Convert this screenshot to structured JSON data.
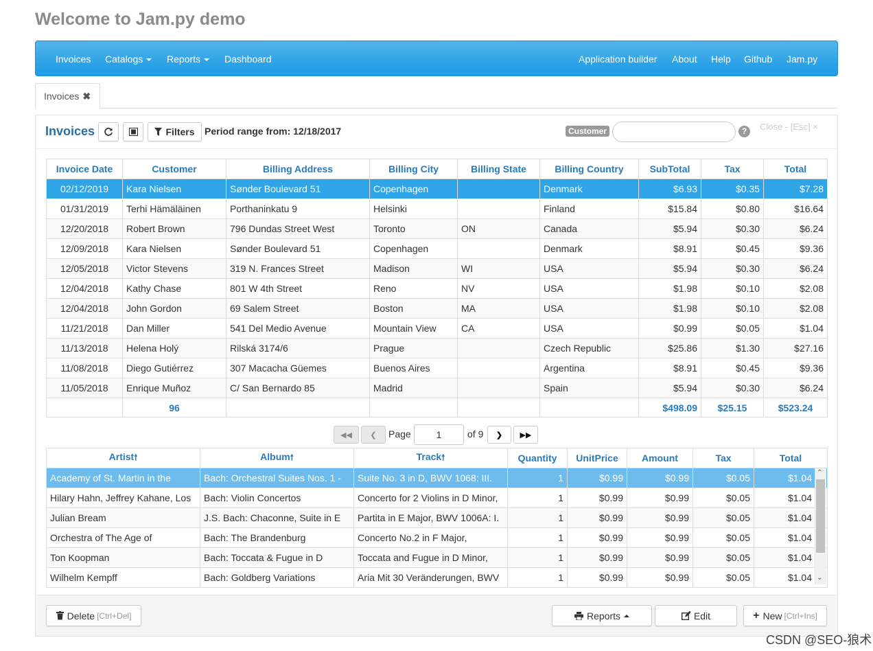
{
  "page": {
    "title": "Welcome to Jam.py demo"
  },
  "nav": {
    "left": [
      "Invoices",
      "Catalogs",
      "Reports",
      "Dashboard"
    ],
    "right": [
      "Application builder",
      "About",
      "Help",
      "Github",
      "Jam.py"
    ]
  },
  "tab": {
    "label": "Invoices",
    "close": "✖"
  },
  "view": {
    "title": "Invoices",
    "filters_label": "Filters",
    "period": "Period range from: 12/18/2017",
    "search_label": "Customer",
    "search_value": "",
    "help": "?",
    "close_link": "Close - [Esc] ×"
  },
  "invoices": {
    "columns": [
      "Invoice Date",
      "Customer",
      "Billing Address",
      "Billing City",
      "Billing State",
      "Billing Country",
      "SubTotal",
      "Tax",
      "Total"
    ],
    "rows": [
      [
        "02/12/2019",
        "Kara Nielsen",
        "Sønder Boulevard 51",
        "Copenhagen",
        "",
        "Denmark",
        "$6.93",
        "$0.35",
        "$7.28"
      ],
      [
        "01/31/2019",
        "Terhi Hämäläinen",
        "Porthaninkatu 9",
        "Helsinki",
        "",
        "Finland",
        "$15.84",
        "$0.80",
        "$16.64"
      ],
      [
        "12/20/2018",
        "Robert Brown",
        "796 Dundas Street West",
        "Toronto",
        "ON",
        "Canada",
        "$5.94",
        "$0.30",
        "$6.24"
      ],
      [
        "12/09/2018",
        "Kara Nielsen",
        "Sønder Boulevard 51",
        "Copenhagen",
        "",
        "Denmark",
        "$8.91",
        "$0.45",
        "$9.36"
      ],
      [
        "12/05/2018",
        "Victor Stevens",
        "319 N. Frances Street",
        "Madison",
        "WI",
        "USA",
        "$5.94",
        "$0.30",
        "$6.24"
      ],
      [
        "12/04/2018",
        "Kathy Chase",
        "801 W 4th Street",
        "Reno",
        "NV",
        "USA",
        "$1.98",
        "$0.10",
        "$2.08"
      ],
      [
        "12/04/2018",
        "John Gordon",
        "69 Salem Street",
        "Boston",
        "MA",
        "USA",
        "$1.98",
        "$0.10",
        "$2.08"
      ],
      [
        "11/21/2018",
        "Dan Miller",
        "541 Del Medio Avenue",
        "Mountain View",
        "CA",
        "USA",
        "$0.99",
        "$0.05",
        "$1.04"
      ],
      [
        "11/13/2018",
        "Helena Holý",
        "Rilská 3174/6",
        "Prague",
        "",
        "Czech Republic",
        "$25.86",
        "$1.30",
        "$27.16"
      ],
      [
        "11/08/2018",
        "Diego Gutiérrez",
        "307 Macacha Güemes",
        "Buenos Aires",
        "",
        "Argentina",
        "$8.91",
        "$0.45",
        "$9.36"
      ],
      [
        "11/05/2018",
        "Enrique Muñoz",
        "C/ San Bernardo 85",
        "Madrid",
        "",
        "Spain",
        "$5.94",
        "$0.30",
        "$6.24"
      ]
    ],
    "footer": [
      "",
      "96",
      "",
      "",
      "",
      "",
      "$498.09",
      "$25.15",
      "$523.24"
    ]
  },
  "pager": {
    "page_label": "Page",
    "page": "1",
    "of_label": "of 9"
  },
  "tracks": {
    "columns": [
      "Artist",
      "Album",
      "Track",
      "Quantity",
      "UnitPrice",
      "Amount",
      "Tax",
      "Total"
    ],
    "sort_arrow": "🠕",
    "rows": [
      [
        "Academy of St. Martin in the",
        "Bach: Orchestral Suites Nos. 1 -",
        "Suite No. 3 in D, BWV 1068: III.",
        "1",
        "$0.99",
        "$0.99",
        "$0.05",
        "$1.04"
      ],
      [
        "Hilary Hahn, Jeffrey Kahane, Los",
        "Bach: Violin Concertos",
        "Concerto for 2 Violins in D Minor,",
        "1",
        "$0.99",
        "$0.99",
        "$0.05",
        "$1.04"
      ],
      [
        "Julian Bream",
        "J.S. Bach: Chaconne, Suite in E",
        "Partita in E Major, BWV 1006A: I.",
        "1",
        "$0.99",
        "$0.99",
        "$0.05",
        "$1.04"
      ],
      [
        "Orchestra of The Age of",
        "Bach: The Brandenburg",
        "Concerto No.2 in F Major,",
        "1",
        "$0.99",
        "$0.99",
        "$0.05",
        "$1.04"
      ],
      [
        "Ton Koopman",
        "Bach: Toccata & Fugue in D",
        "Toccata and Fugue in D Minor,",
        "1",
        "$0.99",
        "$0.99",
        "$0.05",
        "$1.04"
      ],
      [
        "Wilhelm Kempff",
        "Bach: Goldberg Variations",
        "Aria Mit 30 Veränderungen, BWV",
        "1",
        "$0.99",
        "$0.99",
        "$0.05",
        "$1.04"
      ]
    ]
  },
  "actions": {
    "delete": "Delete",
    "delete_hint": "[Ctrl+Del]",
    "reports": "Reports",
    "edit": "Edit",
    "new": "New",
    "new_hint": "[Ctrl+Ins]"
  },
  "watermark": "CSDN @SEO-狼术",
  "colors": {
    "navbar": "#2fa4e7",
    "header_text": "#2a7ab8",
    "selected_row": "#2fa4e7"
  }
}
